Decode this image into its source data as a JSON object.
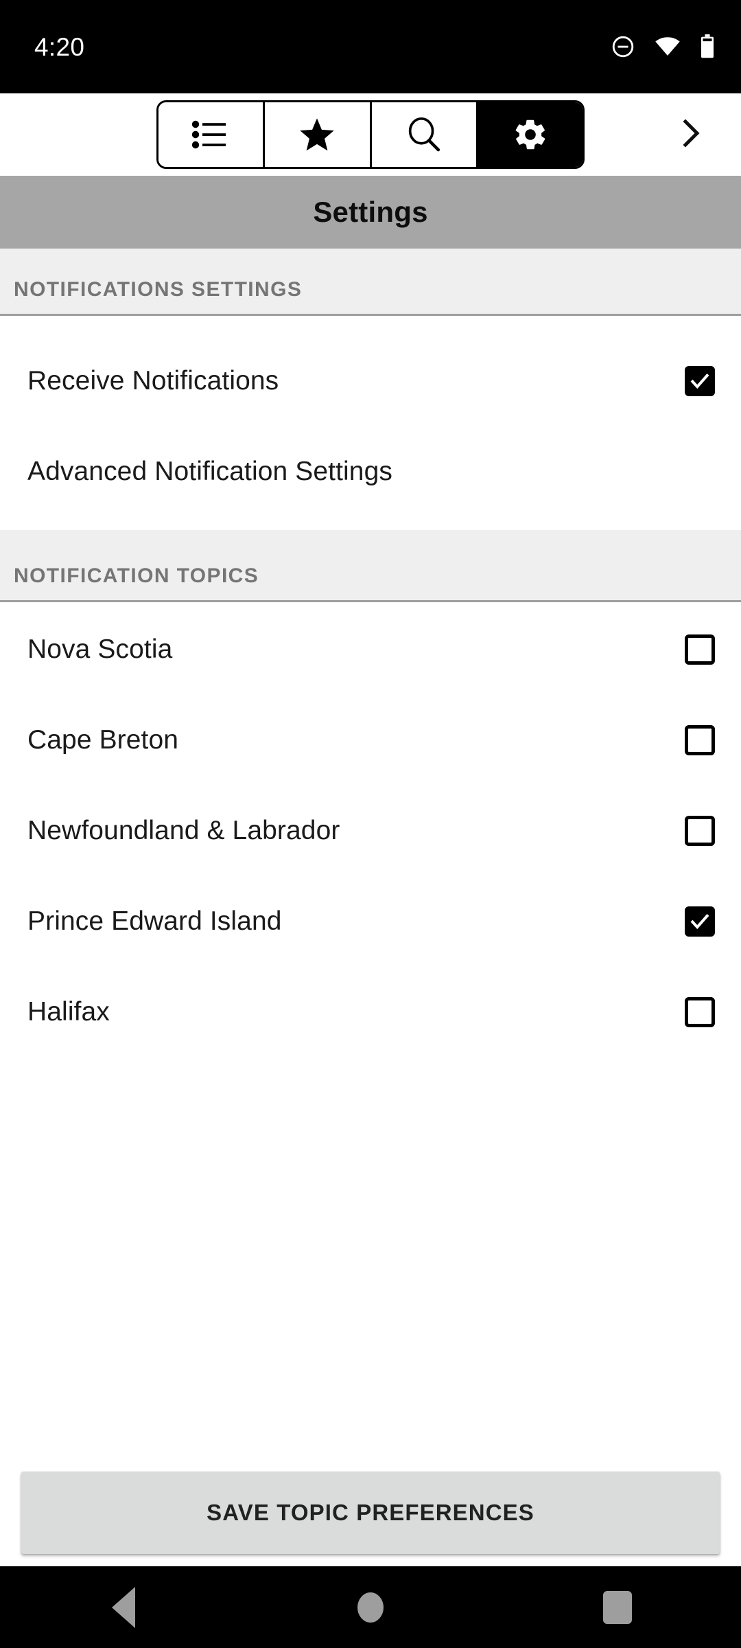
{
  "status_bar": {
    "time": "4:20",
    "icons": [
      "do-not-disturb-icon",
      "wifi-icon",
      "battery-icon"
    ]
  },
  "toolbar": {
    "segments": [
      {
        "id": "list",
        "icon": "list-icon",
        "selected": false
      },
      {
        "id": "favorites",
        "icon": "star-icon",
        "selected": false
      },
      {
        "id": "search",
        "icon": "search-icon",
        "selected": false
      },
      {
        "id": "settings",
        "icon": "gear-icon",
        "selected": true
      }
    ],
    "overflow_icon": "chevron-right-icon"
  },
  "title_bar": {
    "title": "Settings"
  },
  "sections": [
    {
      "header": "NOTIFICATIONS SETTINGS",
      "rows": [
        {
          "label": "Receive Notifications",
          "has_checkbox": true,
          "checked": true
        },
        {
          "label": "Advanced Notification Settings",
          "has_checkbox": false,
          "checked": false
        }
      ]
    },
    {
      "header": "NOTIFICATION TOPICS",
      "rows": [
        {
          "label": "Nova Scotia",
          "has_checkbox": true,
          "checked": false
        },
        {
          "label": "Cape Breton",
          "has_checkbox": true,
          "checked": false
        },
        {
          "label": "Newfoundland & Labrador",
          "has_checkbox": true,
          "checked": false
        },
        {
          "label": "Prince Edward Island",
          "has_checkbox": true,
          "checked": true
        },
        {
          "label": "Halifax",
          "has_checkbox": true,
          "checked": false
        }
      ]
    }
  ],
  "save_button": {
    "label": "SAVE TOPIC PREFERENCES"
  },
  "nav_bar": {
    "buttons": [
      {
        "id": "back",
        "icon": "back-triangle-icon"
      },
      {
        "id": "home",
        "icon": "home-circle-icon"
      },
      {
        "id": "recents",
        "icon": "recents-square-icon"
      }
    ]
  },
  "colors": {
    "status_bar_bg": "#000000",
    "title_bar_bg": "#a6a6a6",
    "section_header_bg": "#efefef",
    "section_header_text": "#757575",
    "divider": "#9e9e9e",
    "content_bg": "#ffffff",
    "accent": "#000000",
    "save_button_bg": "#d9dcdb",
    "nav_icon": "#9e9e9e"
  }
}
